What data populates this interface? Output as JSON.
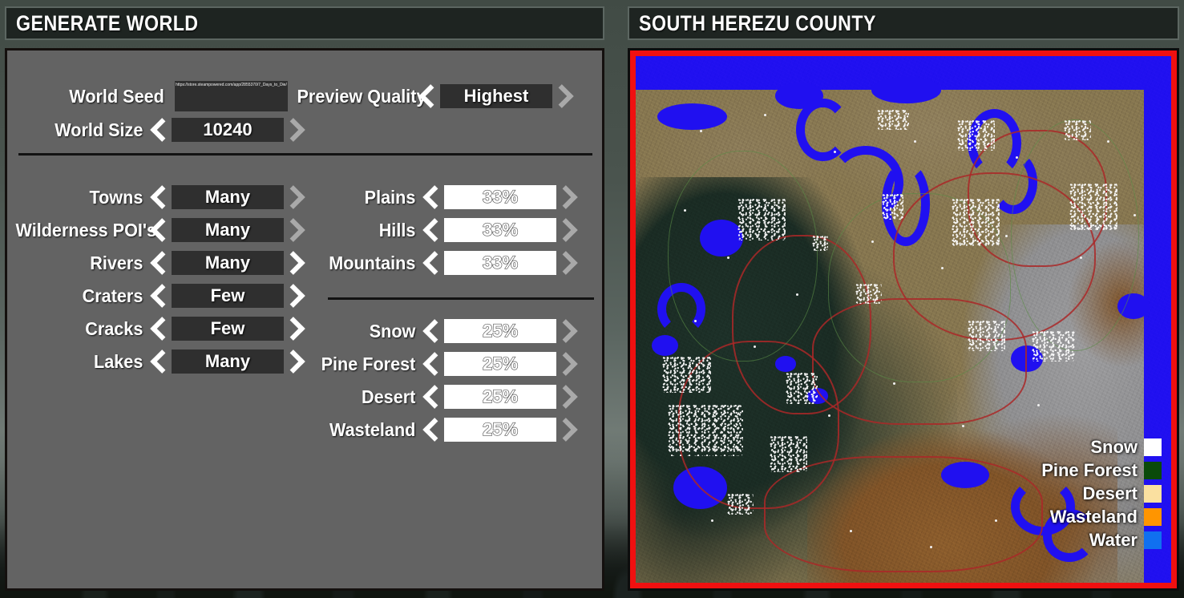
{
  "headers": {
    "left_title": "GENERATE WORLD",
    "right_title": "SOUTH HEREZU COUNTY"
  },
  "settings": {
    "world_seed": {
      "label": "World Seed",
      "value": "https://store.steampowered.com/app/2855370/7_Days_to_Die/"
    },
    "preview_quality": {
      "label": "Preview Quality",
      "value": "Highest"
    },
    "world_size": {
      "label": "World Size",
      "value": "10240"
    },
    "features": [
      {
        "label": "Towns",
        "value": "Many",
        "right_dim": true
      },
      {
        "label": "Wilderness POI's",
        "value": "Many",
        "right_dim": true
      },
      {
        "label": "Rivers",
        "value": "Many",
        "right_dim": false
      },
      {
        "label": "Craters",
        "value": "Few",
        "right_dim": false
      },
      {
        "label": "Cracks",
        "value": "Few",
        "right_dim": false
      },
      {
        "label": "Lakes",
        "value": "Many",
        "right_dim": false
      }
    ],
    "terrain": [
      {
        "label": "Plains",
        "value": "33%",
        "right_dim": true
      },
      {
        "label": "Hills",
        "value": "33%",
        "right_dim": true
      },
      {
        "label": "Mountains",
        "value": "33%",
        "right_dim": true
      }
    ],
    "biomes": [
      {
        "label": "Snow",
        "value": "25%",
        "right_dim": true
      },
      {
        "label": "Pine Forest",
        "value": "25%",
        "right_dim": true
      },
      {
        "label": "Desert",
        "value": "25%",
        "right_dim": true
      },
      {
        "label": "Wasteland",
        "value": "25%",
        "right_dim": true
      }
    ]
  },
  "map_legend": [
    {
      "label": "Snow",
      "color": "#ffffff"
    },
    {
      "label": "Pine Forest",
      "color": "#0a4a0a"
    },
    {
      "label": "Desert",
      "color": "#fae0a0"
    },
    {
      "label": "Wasteland",
      "color": "#ff9500"
    },
    {
      "label": "Water",
      "color": "#1070f0"
    }
  ],
  "colors": {
    "panel_bg": "#636363",
    "value_box": "#2f2f2f",
    "slider_box": "#ffffff",
    "map_border": "#f01010",
    "title_bg": "#1e2421"
  }
}
